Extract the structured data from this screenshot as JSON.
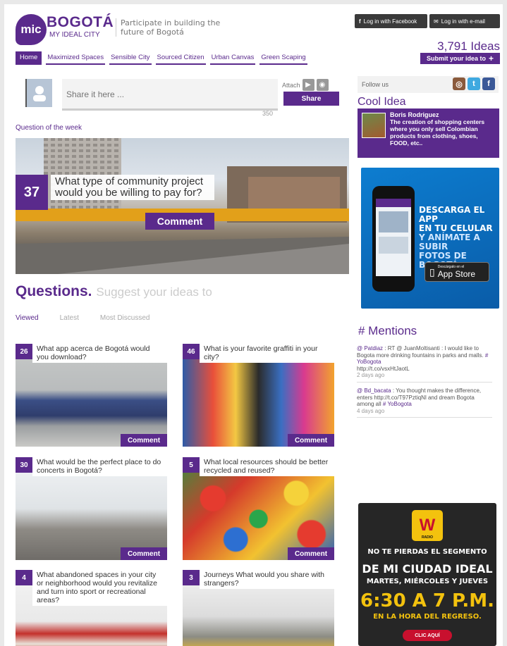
{
  "header": {
    "logo_mic": "mic",
    "logo_name": "BOGOTÁ",
    "logo_sub": "MY IDEAL CITY",
    "tagline": "Participate in building the future of Bogotá",
    "login_facebook": "Log in with Facebook",
    "login_email": "Log in with e-mail",
    "ideas_count": "3,791 Ideas",
    "submit_label": "Submit your idea to"
  },
  "nav": {
    "items": [
      "Home",
      "Maximized Spaces",
      "Sensible City",
      "Sourced Citizen",
      "Urban Canvas",
      "Green Scaping"
    ]
  },
  "share": {
    "placeholder": "Share it here ...",
    "counter": "350",
    "attach_label": "Attach",
    "share_label": "Share"
  },
  "question_of_week": {
    "label": "Question of the week",
    "count": "37",
    "question": "What type of community project would you be willing to pay for?",
    "comment_label": "Comment"
  },
  "questions": {
    "heading": "Questions.",
    "subheading": "Suggest your ideas to",
    "tabs": [
      "Viewed",
      "Latest",
      "Most Discussed"
    ],
    "comment_label": "Comment",
    "cards": [
      {
        "count": "26",
        "question": "What app acerca de Bogotá would you download?"
      },
      {
        "count": "46",
        "question": "What is your favorite graffiti in your city?"
      },
      {
        "count": "30",
        "question": "What would be the perfect place to do concerts in Bogotá?"
      },
      {
        "count": "5",
        "question": "What local resources should be better recycled and reused?"
      },
      {
        "count": "4",
        "question": "What abandoned spaces in your city or neighborhood would you revitalize and turn into sport or recreational areas?"
      },
      {
        "count": "3",
        "question": "Journeys What would you share with strangers?"
      }
    ]
  },
  "sidebar": {
    "follow_label": "Follow us",
    "cool_idea_title": "Cool Idea",
    "cool_idea_name": "Boris Rodriguez",
    "cool_idea_text": "The creation of shopping centers where you only sell Colombian products from clothing, shoes, FOOD, etc..",
    "app_ad": {
      "line1": "DESCARGA EL APP",
      "line2": "EN TU CELULAR",
      "line3": "Y ANÍMATE A SUBIR",
      "line4": "FOTOS DE BOGOTÁ",
      "store_small": "Descárgalo en el",
      "store_name": "App Store"
    },
    "mentions_title": "# Mentions",
    "mentions": [
      {
        "user": "@ Patdiaz",
        "text": ": RT @ JuanMoltisanti : I would like to Bogota more drinking fountains in parks and malls.",
        "tag": "# YoBogota",
        "link": "http://t.co/vsxHtJaotL",
        "ago": "2 days ago"
      },
      {
        "user": "@ Bd_bacata",
        "text": ": You thought makes the difference, enters",
        "link": "http://t.co/T97PztiqNl",
        "text2": "and dream Bogota among all",
        "tag": "# YoBogota",
        "ago": "4 days ago"
      }
    ],
    "radio_ad": {
      "logo": "W",
      "logo_sub": "RADIO",
      "line1": "NO TE PIERDAS EL SEGMENTO",
      "line2": "DE MI CIUDAD IDEAL",
      "line3": "MARTES, MIÉRCOLES Y JUEVES",
      "time": "6:30 A 7 P.M.",
      "line4": "EN LA HORA DEL REGRESO.",
      "button": "CLIC AQUÍ"
    }
  }
}
